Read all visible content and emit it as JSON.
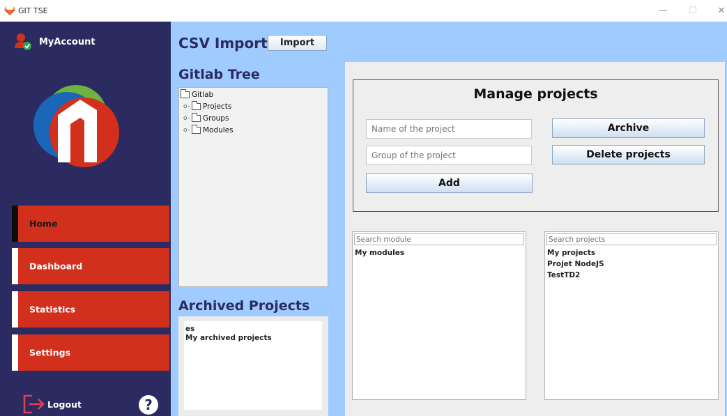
{
  "window": {
    "title": "GIT TSE",
    "minimize": "—",
    "maximize": "☐",
    "close": "✕"
  },
  "sidebar": {
    "account_label": "MyAccount",
    "nav": [
      {
        "label": "Home",
        "active": true
      },
      {
        "label": "Dashboard",
        "active": false
      },
      {
        "label": "Statistics",
        "active": false
      },
      {
        "label": "Settings",
        "active": false
      }
    ],
    "logout_label": "Logout",
    "help_label": "?"
  },
  "main": {
    "csv_heading": "CSV Import",
    "import_label": "Import",
    "tree_heading": "Gitlab Tree",
    "tree": {
      "root": "Gitlab",
      "children": [
        "Projects",
        "Groups",
        "Modules"
      ]
    },
    "archived_heading": "Archived Projects",
    "archived_items": [
      "es",
      "My archived projects"
    ]
  },
  "manage": {
    "title": "Manage projects",
    "name_placeholder": "Name of the project",
    "group_placeholder": "Group of the project",
    "archive_label": "Archive",
    "delete_label": "Delete projects",
    "add_label": "Add"
  },
  "modules": {
    "search_placeholder": "Search module",
    "items": [
      "My modules"
    ]
  },
  "projects": {
    "search_placeholder": "Search projects",
    "items": [
      "My projects",
      "Projet NodeJS",
      "TestTD2"
    ]
  },
  "colors": {
    "sidebar_bg": "#2b2b61",
    "nav_red": "#d2301c",
    "main_bg": "#9fcbff",
    "panel_bg": "#eeeeee"
  }
}
